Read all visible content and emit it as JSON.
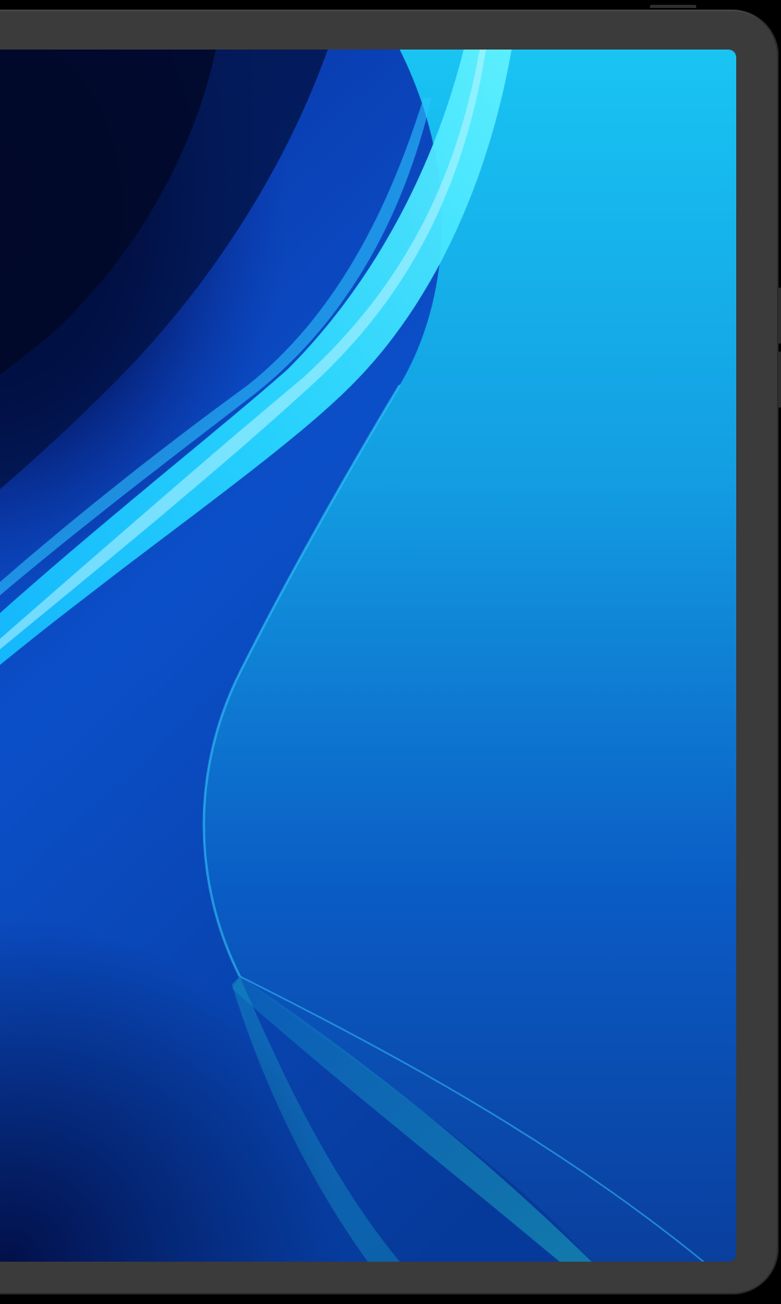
{
  "device": {
    "type": "tablet",
    "frame_color": "#3b3b3b"
  },
  "wallpaper": {
    "description_icon": "wallpaper-abstract-waves",
    "colors": {
      "deep_navy": "#020a3a",
      "royal_blue": "#0a48c4",
      "bright_cyan": "#1fd3ff",
      "sky_blue": "#14a4e6",
      "teal": "#1aa3b8"
    }
  }
}
